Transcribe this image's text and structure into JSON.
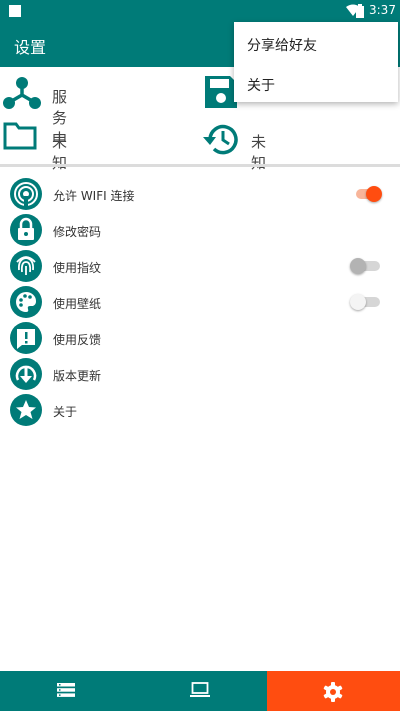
{
  "status_bar": {
    "time": "3:37",
    "icons": [
      "notification-square-icon",
      "wifi-icon",
      "battery-icon"
    ]
  },
  "app_bar": {
    "title": "设置"
  },
  "overflow_menu": {
    "items": [
      "分享给好友",
      "关于"
    ]
  },
  "status_cards": [
    {
      "icon": "network-node-icon",
      "text": "服务中"
    },
    {
      "icon": "save-floppy-icon",
      "text": ""
    },
    {
      "icon": "folder-icon",
      "text": "未知"
    },
    {
      "icon": "history-icon",
      "text": "未知"
    }
  ],
  "settings": [
    {
      "icon": "wifi-signal-icon",
      "label": "允许 WIFI 连接",
      "toggle": "on"
    },
    {
      "icon": "lock-icon",
      "label": "修改密码"
    },
    {
      "icon": "fingerprint-icon",
      "label": "使用指纹",
      "toggle": "off"
    },
    {
      "icon": "palette-icon",
      "label": "使用壁纸",
      "toggle": "off"
    },
    {
      "icon": "feedback-icon",
      "label": "使用反馈"
    },
    {
      "icon": "download-icon",
      "label": "版本更新"
    },
    {
      "icon": "star-icon",
      "label": "关于"
    }
  ],
  "bottom_nav": {
    "tabs": [
      "list-icon",
      "laptop-icon",
      "gear-icon"
    ],
    "active": 2
  },
  "colors": {
    "primary": "#007b78",
    "accent": "#ff4d10"
  }
}
